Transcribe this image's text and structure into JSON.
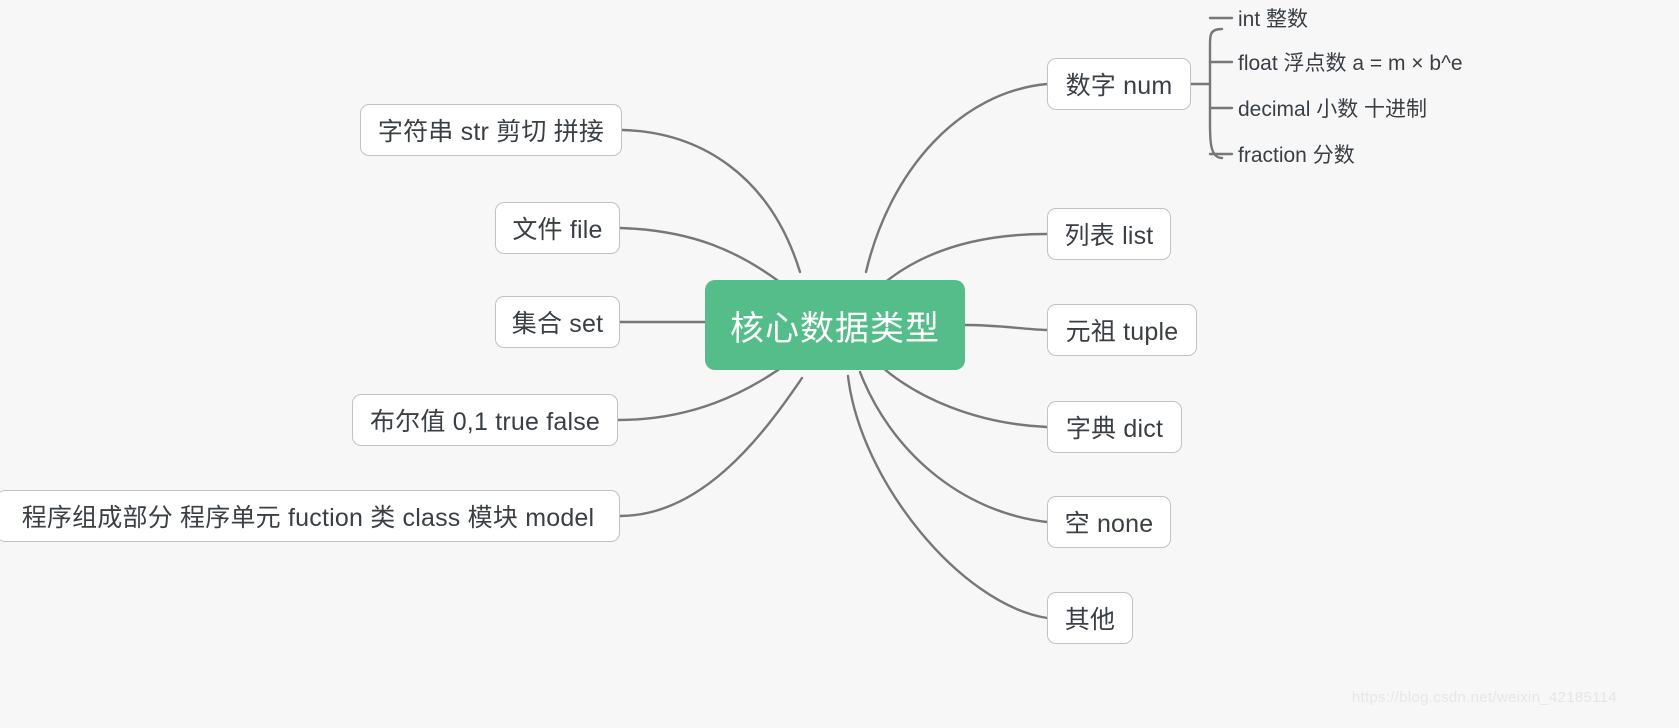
{
  "diagram": {
    "title_node": "核心数据类型",
    "type": "mind-map",
    "background_color": "#f7f7f7",
    "central_node_color": "#55bd8a",
    "node_border_color": "#c2c2c2",
    "connector_color": "#777777",
    "text_color": "#3a3f45"
  },
  "left_branches": [
    {
      "label": "字符串 str  剪切 拼接"
    },
    {
      "label": "文件 file"
    },
    {
      "label": "集合 set"
    },
    {
      "label": "布尔值 0,1 true  false"
    },
    {
      "label": "程序组成部分  程序单元 fuction  类 class  模块  model"
    }
  ],
  "right_branches": [
    {
      "label": "数字 num"
    },
    {
      "label": "列表 list"
    },
    {
      "label": "元祖 tuple"
    },
    {
      "label": "字典 dict"
    },
    {
      "label": "空 none"
    },
    {
      "label": "其他"
    }
  ],
  "num_sub_branches": [
    {
      "label": "int  整数"
    },
    {
      "label": "float  浮点数  a = m × b^e"
    },
    {
      "label": "decimal  小数  十进制"
    },
    {
      "label": "fraction  分数"
    }
  ],
  "watermark": "https://blog.csdn.net/weixin_42185114"
}
